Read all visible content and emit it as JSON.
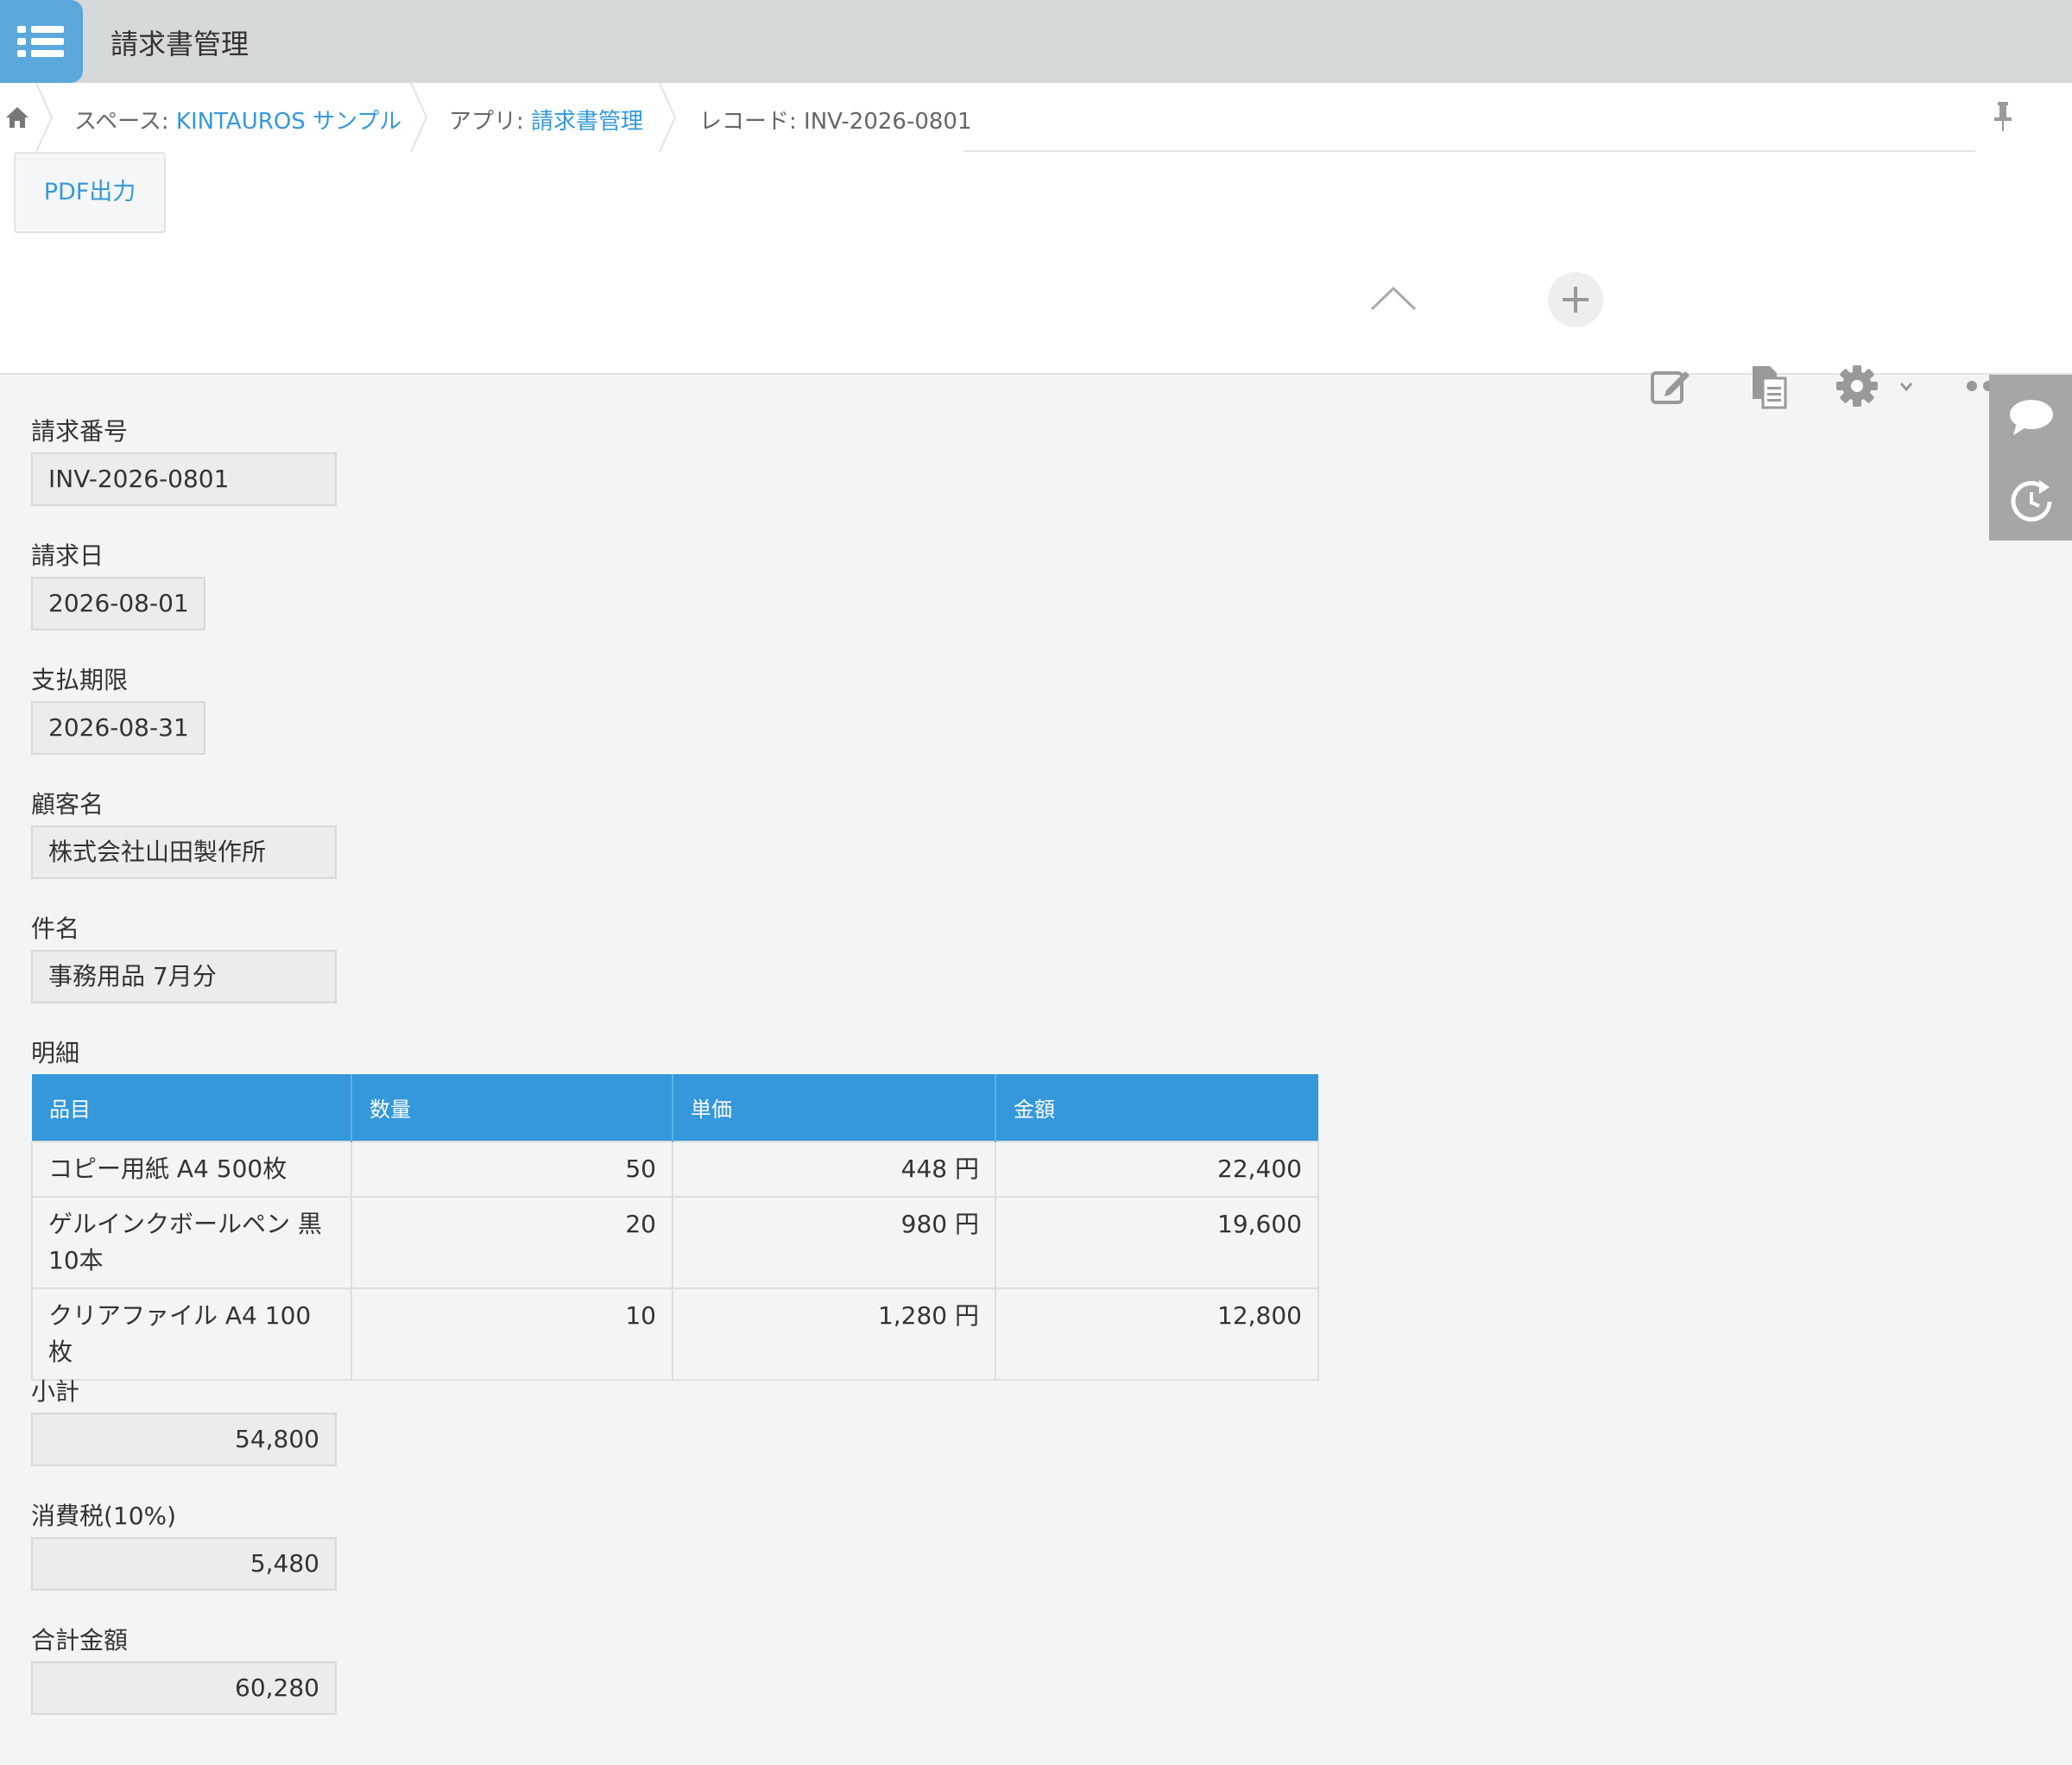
{
  "header": {
    "app_name": "請求書管理"
  },
  "breadcrumb": {
    "space_prefix": "スペース: ",
    "space_name": "KINTAUROS サンプル",
    "app_prefix": "アプリ: ",
    "app_name": "請求書管理",
    "record_label": "レコード: INV-2026-0801"
  },
  "actions": {
    "pdf_button": "PDF出力"
  },
  "fields": {
    "invoice_no": {
      "label": "請求番号",
      "value": "INV-2026-0801"
    },
    "invoice_date": {
      "label": "請求日",
      "value": "2026-08-01"
    },
    "due_date": {
      "label": "支払期限",
      "value": "2026-08-31"
    },
    "customer": {
      "label": "顧客名",
      "value": "株式会社山田製作所"
    },
    "subject": {
      "label": "件名",
      "value": "事務用品 7月分"
    },
    "details_label": "明細",
    "subtotal": {
      "label": "小計",
      "value": "54,800"
    },
    "tax": {
      "label": "消費税(10%)",
      "value": "5,480"
    },
    "total": {
      "label": "合計金額",
      "value": "60,280"
    }
  },
  "table": {
    "headers": [
      "品目",
      "数量",
      "単価",
      "金額"
    ],
    "rows": [
      [
        "コピー用紙 A4 500枚",
        "50",
        "448 円",
        "22,400"
      ],
      [
        "ゲルインクボールペン 黒 10本",
        "20",
        "980 円",
        "19,600"
      ],
      [
        "クリアファイル A4 100枚",
        "10",
        "1,280 円",
        "12,800"
      ]
    ]
  },
  "colors": {
    "accent": "#3498db",
    "header_bg": "#d5d9da",
    "app_icon": "#5aa8dc"
  },
  "icons": [
    "list-icon",
    "home-icon",
    "pin-icon",
    "collapse-chevron-icon",
    "add-icon",
    "edit-icon",
    "duplicate-icon",
    "gear-icon",
    "chevron-down-icon",
    "more-icon",
    "comment-icon",
    "history-icon"
  ]
}
